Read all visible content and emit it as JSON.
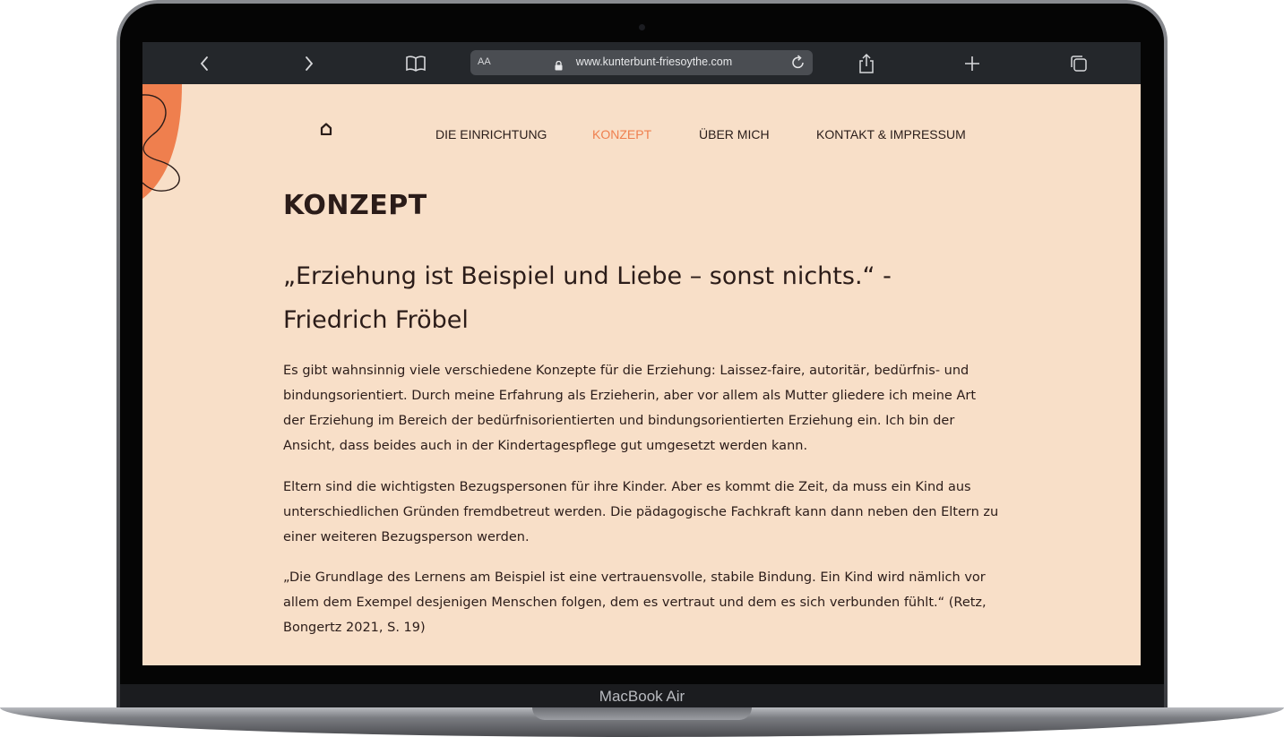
{
  "device": {
    "brand_label": "MacBook Air"
  },
  "browser": {
    "address_text_size_label": "AA",
    "url": "www.kunterbunt-friesoythe.com",
    "icons": [
      "chevron-left-icon",
      "chevron-right-icon",
      "bookmarks-icon",
      "lock-icon",
      "reload-icon",
      "share-icon",
      "plus-icon",
      "tabs-icon"
    ]
  },
  "site": {
    "accent_color": "#ef7f4e",
    "background_color": "#f8dfc8",
    "nav": {
      "home_icon": "home-icon",
      "items": [
        {
          "label": "DIE EINRICHTUNG",
          "active": false
        },
        {
          "label": "KONZEPT",
          "active": true
        },
        {
          "label": "ÜBER MICH",
          "active": false
        },
        {
          "label": "KONTAKT & IMPRESSUM",
          "active": false
        }
      ]
    },
    "heading": "KONZEPT",
    "quote": "„Erziehung ist Beispiel und Liebe – sonst nichts.“ - Friedrich Fröbel",
    "paragraphs": [
      "Es gibt wahnsinnig viele verschiedene Konzepte für die Erziehung: Laissez-faire, autoritär, bedürfnis- und bindungsorientiert. Durch meine Erfahrung als Erzieherin, aber vor allem als Mutter gliedere ich meine Art der Erziehung im Bereich der bedürfnisorientierten und bindungsorientierten Erziehung ein. Ich bin der Ansicht, dass beides auch in der Kindertagespflege gut umgesetzt werden kann.",
      "Eltern sind die wichtigsten Bezugspersonen für ihre Kinder. Aber es kommt die Zeit, da muss ein Kind aus unterschiedlichen Gründen fremdbetreut werden. Die pädagogische Fachkraft kann dann neben den Eltern zu einer weiteren Bezugsperson werden.",
      "„Die Grundlage des Lernens am Beispiel ist eine vertrauensvolle, stabile Bindung. Ein Kind wird nämlich vor allem dem Exempel desjenigen Menschen folgen, dem es vertraut und dem es sich verbunden fühlt.“ (Retz, Bongertz 2021, S. 19)"
    ]
  }
}
